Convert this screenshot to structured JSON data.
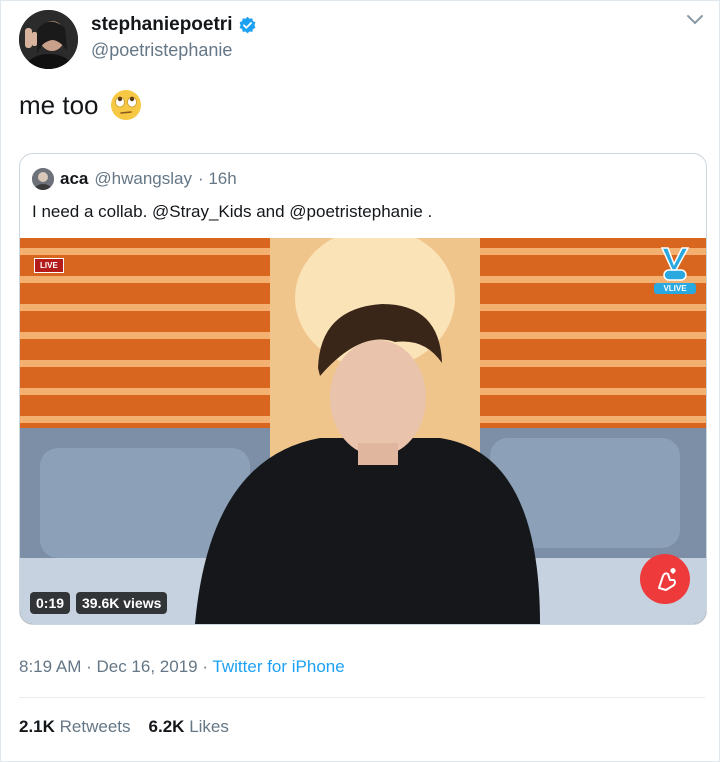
{
  "author": {
    "display_name": "stephaniepoetri",
    "handle": "@poetristephanie",
    "verified": true
  },
  "tweet": {
    "text": "me too",
    "emoji": "eye-roll-emoji"
  },
  "quoted_tweet": {
    "display_name": "aca",
    "handle": "@hwangslay",
    "time": "· 16h",
    "text": "I need a collab. @Stray_Kids and @poetristephanie .",
    "video": {
      "duration": "0:19",
      "views": "39.6K views",
      "live_tag": "LIVE",
      "watermark": "VLIVE"
    }
  },
  "meta": {
    "time_date": "8:19 AM · Dec 16, 2019 ·",
    "source": "Twitter for iPhone"
  },
  "stats": {
    "retweets_count": "2.1K",
    "retweets_label": "Retweets",
    "likes_count": "6.2K",
    "likes_label": "Likes"
  },
  "colors": {
    "link_blue": "#1da1f2",
    "secondary_text": "#657786",
    "verified_blue": "#1da1f2",
    "video_orange": "#e0651e"
  }
}
